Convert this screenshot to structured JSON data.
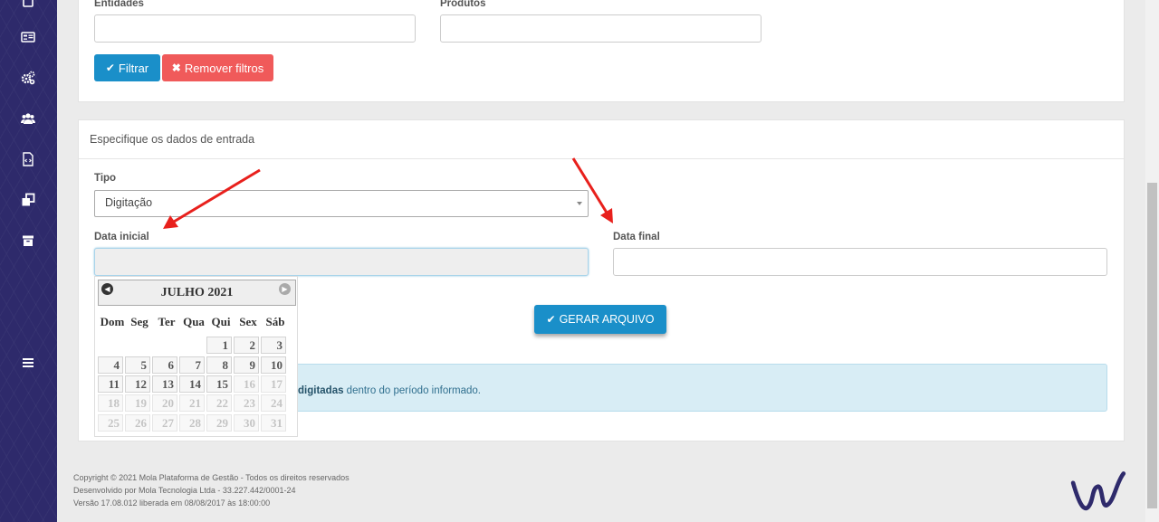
{
  "filters": {
    "entidades_label": "Entidades",
    "produtos_label": "Produtos",
    "filtrar_label": "Filtrar",
    "remover_label": "Remover filtros"
  },
  "entrada": {
    "title": "Especifique os dados de entrada",
    "tipo_label": "Tipo",
    "tipo_value": "Digitação",
    "data_inicial_label": "Data inicial",
    "data_final_label": "Data final",
    "gerar_label": "GERAR ARQUIVO",
    "info_bold": "digitadas",
    "info_text": " dentro do período informado."
  },
  "datepicker": {
    "title": "JULHO 2021",
    "weekdays": [
      "Dom",
      "Seg",
      "Ter",
      "Qua",
      "Qui",
      "Sex",
      "Sáb"
    ],
    "weeks": [
      [
        null,
        null,
        null,
        null,
        "1",
        "2",
        "3"
      ],
      [
        "4",
        "5",
        "6",
        "7",
        "8",
        "9",
        "10"
      ],
      [
        "11",
        "12",
        "13",
        "14",
        "15",
        "16",
        "17"
      ],
      [
        "18",
        "19",
        "20",
        "21",
        "22",
        "23",
        "24"
      ],
      [
        "25",
        "26",
        "27",
        "28",
        "29",
        "30",
        "31"
      ]
    ],
    "enabled_through": 15
  },
  "footer": {
    "line1": "Copyright © 2021 Mola Plataforma de Gestão - Todos os direitos reservados",
    "line2": "Desenvolvido por Mola Tecnologia Ltda - 33.227.442/0001-24",
    "line3": "Versão 17.08.012 liberada em 08/08/2017 às 18:00:00"
  },
  "colors": {
    "sidebar": "#2e2a6b",
    "primary": "#1a8fc9",
    "danger": "#f05a5a",
    "info_bg": "#d8edf5",
    "arrow": "#e8201c"
  },
  "icons": [
    "document-icon",
    "id-card-icon",
    "cogs-icon",
    "users-icon",
    "file-code-icon",
    "clone-icon",
    "archive-icon",
    "menu-icon"
  ]
}
